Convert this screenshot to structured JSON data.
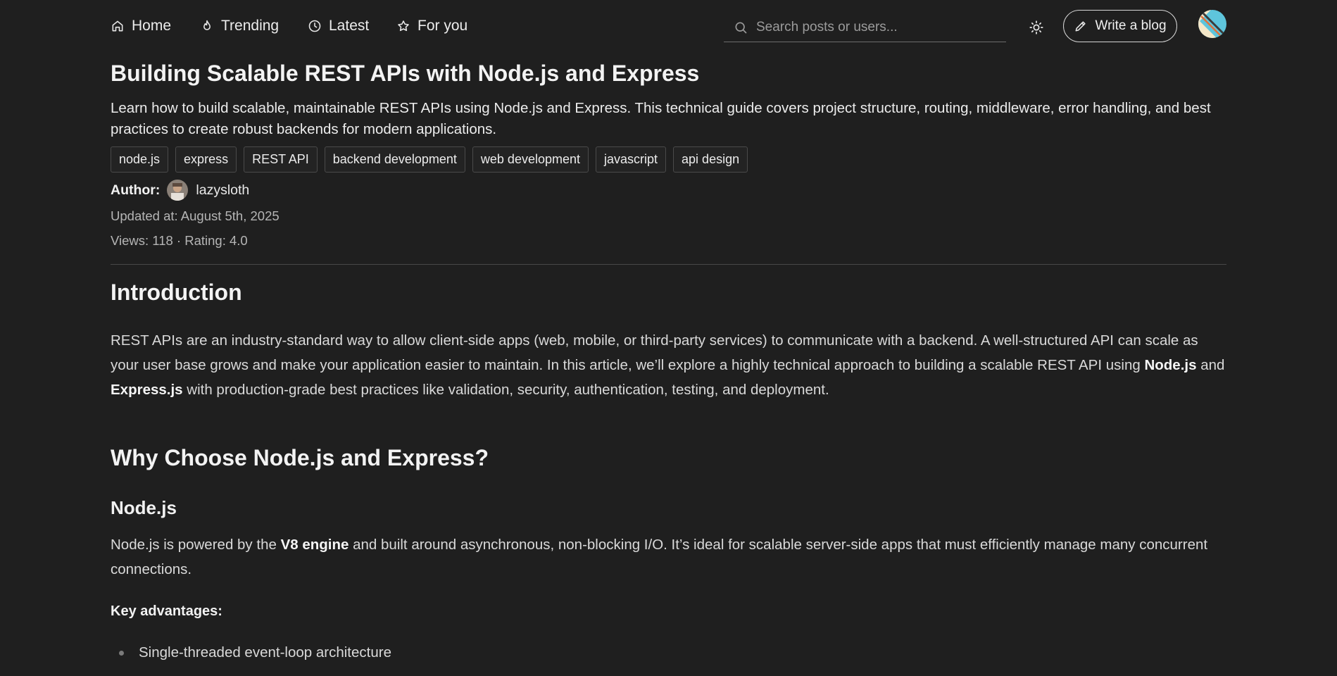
{
  "nav": {
    "home": "Home",
    "trending": "Trending",
    "latest": "Latest",
    "for_you": "For you",
    "search_placeholder": "Search posts or users...",
    "write_button": "Write a blog"
  },
  "post": {
    "title": "Building Scalable REST APIs with Node.js and Express",
    "description": "Learn how to build scalable, maintainable REST APIs using Node.js and Express. This technical guide covers project structure, routing, middleware, error handling, and best practices to create robust backends for modern applications.",
    "tags": [
      "node.js",
      "express",
      "REST API",
      "backend development",
      "web development",
      "javascript",
      "api design"
    ],
    "author_label": "Author:",
    "author_name": "lazysloth",
    "updated": "Updated at: August 5th, 2025",
    "stats": "Views: 118 · Rating: 4.0"
  },
  "article": {
    "intro_heading": "Introduction",
    "intro_part1": "REST APIs are an industry-standard way to allow client-side apps (web, mobile, or third-party services) to communicate with a backend. A well-structured API can scale as your user base grows and make your application easier to maintain. In this article, we’ll explore a highly technical approach to building a scalable REST API using ",
    "intro_bold1": "Node.js",
    "intro_part2": " and ",
    "intro_bold2": "Express.js",
    "intro_part3": " with production-grade best practices like validation, security, authentication, testing, and deployment.",
    "why_heading": "Why Choose Node.js and Express?",
    "node_heading": "Node.js",
    "node_part1": "Node.js is powered by the ",
    "node_bold": "V8 engine",
    "node_part2": " and built around asynchronous, non-blocking I/O. It’s ideal for scalable server-side apps that must efficiently manage many concurrent connections.",
    "key_advantages": "Key advantages:",
    "list": [
      "Single-threaded event-loop architecture"
    ]
  }
}
